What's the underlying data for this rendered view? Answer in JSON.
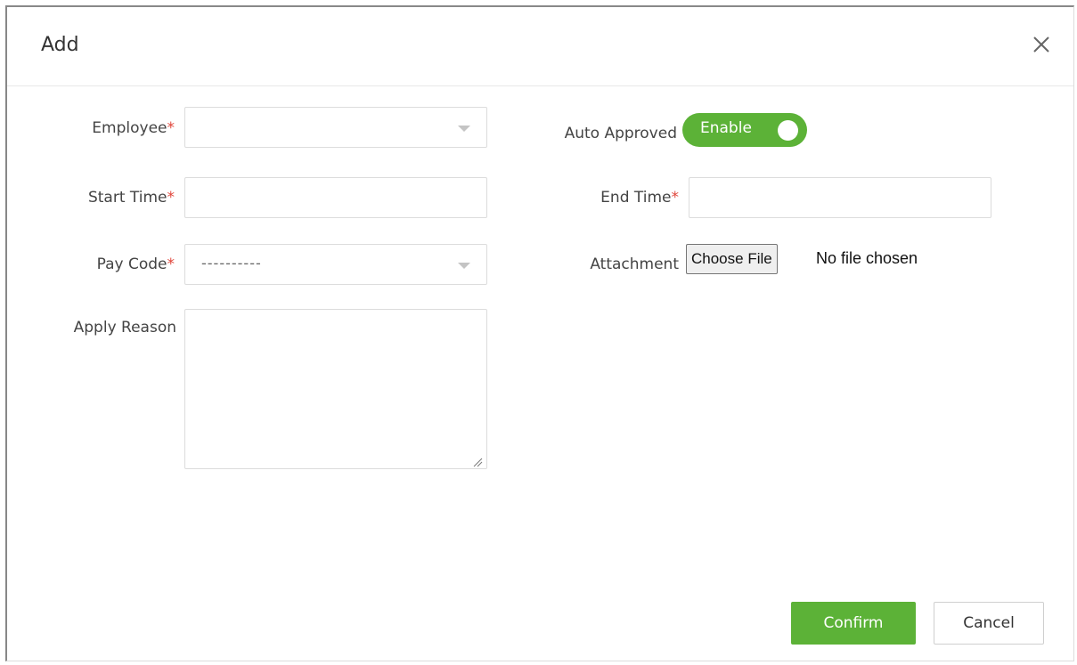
{
  "dialog": {
    "title": "Add",
    "close_icon": "close-icon"
  },
  "form": {
    "employee": {
      "label": "Employee",
      "required_mark": "*",
      "value": ""
    },
    "auto_approved": {
      "label": "Auto Approved",
      "toggle_text": "Enable",
      "enabled": true
    },
    "start_time": {
      "label": "Start Time",
      "required_mark": "*",
      "value": ""
    },
    "end_time": {
      "label": "End Time",
      "required_mark": "*",
      "value": ""
    },
    "pay_code": {
      "label": "Pay Code",
      "required_mark": "*",
      "value": "----------"
    },
    "attachment": {
      "label": "Attachment",
      "button": "Choose File",
      "status": "No file chosen"
    },
    "apply_reason": {
      "label": "Apply Reason",
      "value": ""
    }
  },
  "footer": {
    "confirm": "Confirm",
    "cancel": "Cancel"
  },
  "colors": {
    "accent": "#5cb237",
    "required": "#e0453a",
    "border": "#dcdcdc"
  }
}
